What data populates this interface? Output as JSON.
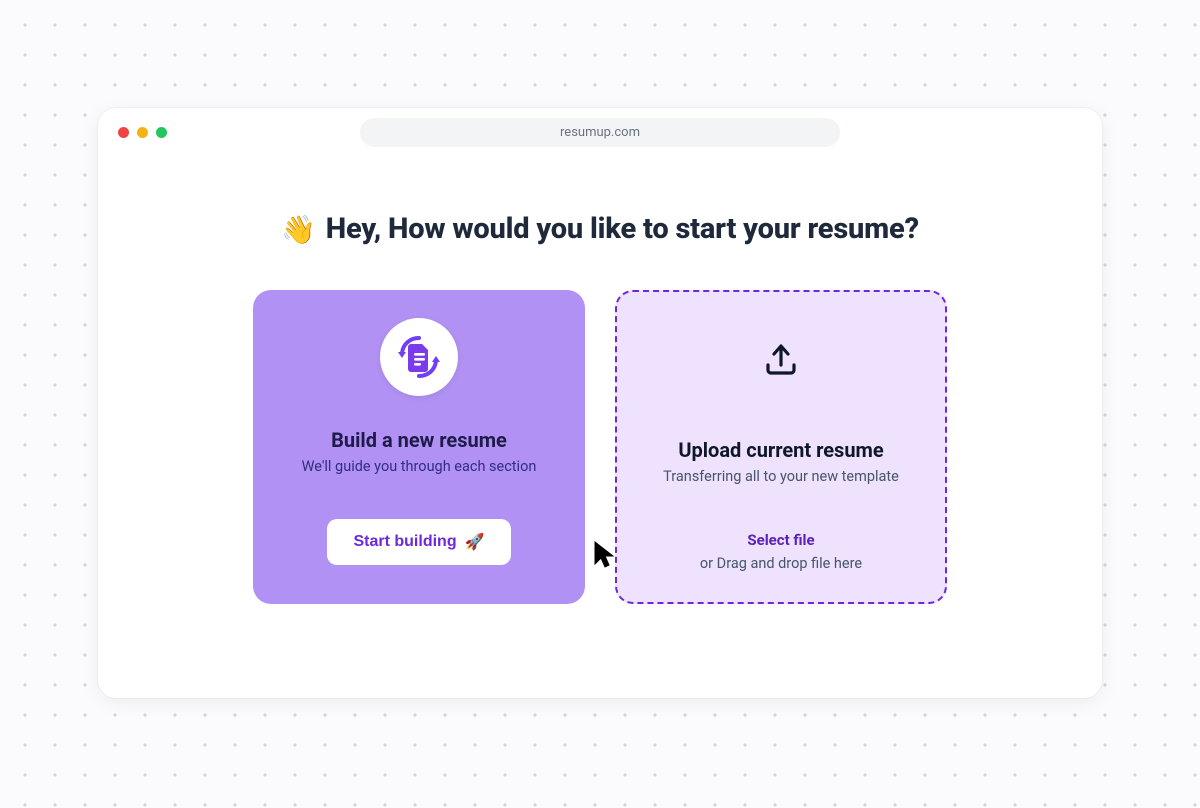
{
  "address_bar": {
    "url": "resumup.com"
  },
  "heading": {
    "emoji": "👋",
    "text": "Hey, How would you like to start your resume?"
  },
  "cards": {
    "build": {
      "title": "Build a new resume",
      "subtitle": "We'll guide you through each section",
      "button_label": "Start building",
      "button_emoji": "🚀"
    },
    "upload": {
      "title": "Upload current resume",
      "subtitle": "Transferring all to your new template",
      "select_label": "Select file",
      "drop_label": "or Drag and drop file here"
    }
  }
}
